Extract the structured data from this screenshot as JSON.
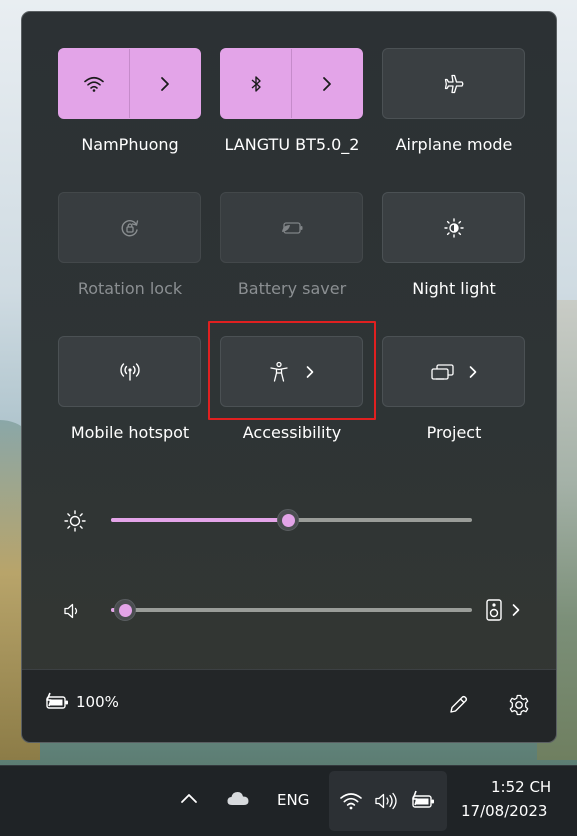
{
  "quick_settings": {
    "tiles": [
      {
        "label": "NamPhuong",
        "icon": "wifi-icon",
        "state": "on",
        "has_arrow": true
      },
      {
        "label": "LANGTU BT5.0_2",
        "icon": "bluetooth-icon",
        "state": "on",
        "has_arrow": true
      },
      {
        "label": "Airplane mode",
        "icon": "airplane-icon",
        "state": "off",
        "has_arrow": false
      },
      {
        "label": "Rotation lock",
        "icon": "rotation-lock-icon",
        "state": "disabled",
        "has_arrow": false
      },
      {
        "label": "Battery saver",
        "icon": "battery-saver-icon",
        "state": "disabled",
        "has_arrow": false
      },
      {
        "label": "Night light",
        "icon": "night-light-icon",
        "state": "off",
        "has_arrow": false
      },
      {
        "label": "Mobile hotspot",
        "icon": "hotspot-icon",
        "state": "off",
        "has_arrow": false
      },
      {
        "label": "Accessibility",
        "icon": "accessibility-icon",
        "state": "off",
        "has_arrow": true,
        "highlighted": true
      },
      {
        "label": "Project",
        "icon": "project-icon",
        "state": "off",
        "has_arrow": true
      }
    ],
    "brightness": {
      "icon": "brightness-icon",
      "level": 0.49
    },
    "volume": {
      "icon": "speaker-icon",
      "level": 0.04,
      "output_icon": "audio-output-icon"
    },
    "footer": {
      "battery_icon": "battery-charging-icon",
      "battery_text": "100%",
      "edit_icon": "pencil-icon",
      "settings_icon": "gear-icon"
    }
  },
  "taskbar": {
    "chevron_icon": "chevron-up-icon",
    "weather_icon": "cloud-icon",
    "language": "ENG",
    "tray_icons": [
      "wifi-icon",
      "speaker-icon",
      "battery-charging-icon"
    ],
    "time": "1:52 CH",
    "date": "17/08/2023"
  },
  "colors": {
    "accent": "#e3a4e8",
    "highlight_box": "#e02020"
  }
}
